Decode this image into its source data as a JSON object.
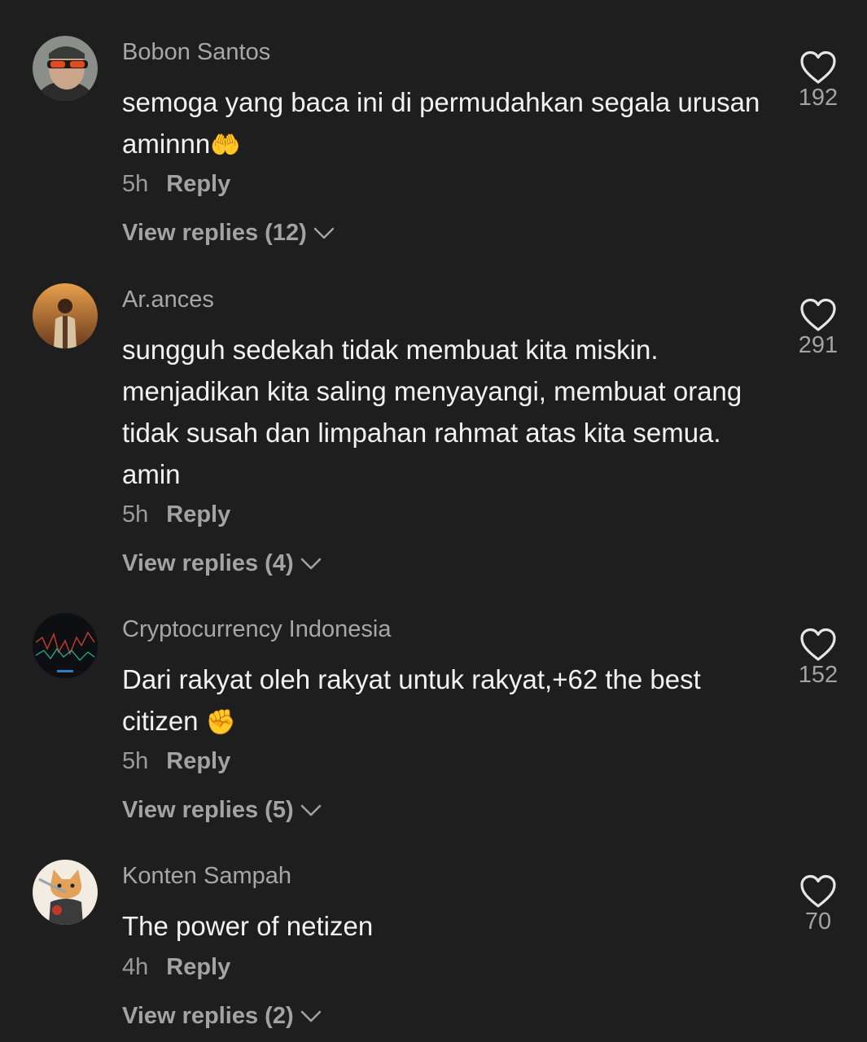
{
  "comments": [
    {
      "username": "Bobon Santos",
      "text": "semoga yang baca ini di permudahkan segala urusan aminnn",
      "emoji": "🤲",
      "time": "5h",
      "reply": "Reply",
      "view_replies": "View replies (12)",
      "likes": "192",
      "avatar_icon": "avatar-sunglasses-man"
    },
    {
      "username": "Ar.ances",
      "text": "sungguh sedekah tidak membuat kita miskin. menjadikan kita saling menyayangi, membuat orang tidak susah dan limpahan rahmat atas kita semua. amin",
      "emoji": "",
      "time": "5h",
      "reply": "Reply",
      "view_replies": "View replies (4)",
      "likes": "291",
      "avatar_icon": "avatar-sunset-man"
    },
    {
      "username": "Cryptocurrency Indonesia",
      "text": "Dari rakyat oleh rakyat untuk rakyat,+62 the best citizen ",
      "emoji": "✊",
      "time": "5h",
      "reply": "Reply",
      "view_replies": "View replies (5)",
      "likes": "152",
      "avatar_icon": "avatar-crypto-chart"
    },
    {
      "username": "Konten Sampah",
      "text": "The power of netizen",
      "emoji": "",
      "time": "4h",
      "reply": "Reply",
      "view_replies": "View replies (2)",
      "likes": "70",
      "avatar_icon": "avatar-cat-illustration"
    }
  ],
  "colors": {
    "background": "#1e1e1f",
    "username": "#a7a7a8",
    "text": "#f2f2f2",
    "secondary": "#a3a3a4"
  }
}
